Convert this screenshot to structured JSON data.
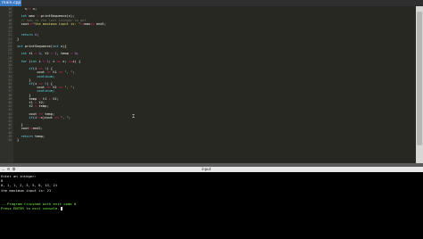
{
  "tab": {
    "label": "main.cpp"
  },
  "editor": {
    "lines": [
      {
        "n": "15",
        "parts": [
          {
            "t": "    s",
            "c": "id"
          },
          {
            "t": "/=",
            "c": "op"
          },
          {
            "t": " x;",
            "c": "id"
          }
        ]
      },
      {
        "n": "16",
        "parts": [
          {
            "t": "  ",
            "c": "id"
          }
        ]
      },
      {
        "n": "17",
        "parts": [
          {
            "t": "  int",
            "c": "ty"
          },
          {
            "t": " max ",
            "c": "id"
          },
          {
            "t": "=",
            "c": "op"
          },
          {
            "t": " printSequence(x);",
            "c": "id"
          }
        ]
      },
      {
        "n": "18",
        "parts": [
          {
            "t": "  // max is the last integer to get",
            "c": "cm"
          }
        ]
      },
      {
        "n": "19",
        "parts": [
          {
            "t": "  cout",
            "c": "id"
          },
          {
            "t": "<<",
            "c": "op"
          },
          {
            "t": "\"the maximum input is: \"",
            "c": "str"
          },
          {
            "t": "<<",
            "c": "op"
          },
          {
            "t": "max",
            "c": "id"
          },
          {
            "t": "<<",
            "c": "op"
          },
          {
            "t": " endl;",
            "c": "id"
          }
        ]
      },
      {
        "n": "20",
        "parts": [
          {
            "t": "",
            "c": "id"
          }
        ]
      },
      {
        "n": "21",
        "parts": [
          {
            "t": "",
            "c": "id"
          }
        ]
      },
      {
        "n": "22",
        "parts": [
          {
            "t": "  return",
            "c": "kw"
          },
          {
            "t": " ",
            "c": "id"
          },
          {
            "t": "0",
            "c": "num"
          },
          {
            "t": ";",
            "c": "id"
          }
        ]
      },
      {
        "n": "23",
        "parts": [
          {
            "t": "}",
            "c": "id"
          }
        ]
      },
      {
        "n": "24",
        "parts": [
          {
            "t": "",
            "c": "id"
          }
        ]
      },
      {
        "n": "25",
        "parts": [
          {
            "t": "int",
            "c": "ty"
          },
          {
            "t": " printSequence(",
            "c": "id"
          },
          {
            "t": "int",
            "c": "ty"
          },
          {
            "t": " x){",
            "c": "id"
          }
        ]
      },
      {
        "n": "26",
        "parts": [
          {
            "t": "",
            "c": "id"
          }
        ]
      },
      {
        "n": "27",
        "parts": [
          {
            "t": "  int",
            "c": "ty"
          },
          {
            "t": " t1 ",
            "c": "id"
          },
          {
            "t": "=",
            "c": "op"
          },
          {
            "t": " ",
            "c": "id"
          },
          {
            "t": "0",
            "c": "num"
          },
          {
            "t": ", t2 ",
            "c": "id"
          },
          {
            "t": "=",
            "c": "op"
          },
          {
            "t": " ",
            "c": "id"
          },
          {
            "t": "1",
            "c": "num"
          },
          {
            "t": ", temp ",
            "c": "id"
          },
          {
            "t": "=",
            "c": "op"
          },
          {
            "t": " ",
            "c": "id"
          },
          {
            "t": "0",
            "c": "num"
          },
          {
            "t": ";",
            "c": "id"
          }
        ]
      },
      {
        "n": "28",
        "parts": [
          {
            "t": "",
            "c": "id"
          }
        ]
      },
      {
        "n": "29",
        "parts": [
          {
            "t": "  for",
            "c": "kw"
          },
          {
            "t": " (",
            "c": "id"
          },
          {
            "t": "int",
            "c": "ty"
          },
          {
            "t": " i ",
            "c": "id"
          },
          {
            "t": "=",
            "c": "op"
          },
          {
            "t": " ",
            "c": "id"
          },
          {
            "t": "1",
            "c": "num"
          },
          {
            "t": "; i ",
            "c": "id"
          },
          {
            "t": "<=",
            "c": "op"
          },
          {
            "t": " x; ",
            "c": "id"
          },
          {
            "t": "++",
            "c": "op"
          },
          {
            "t": "i) {",
            "c": "id"
          }
        ]
      },
      {
        "n": "30",
        "parts": [
          {
            "t": "",
            "c": "id"
          }
        ]
      },
      {
        "n": "31",
        "parts": [
          {
            "t": "      if",
            "c": "kw"
          },
          {
            "t": "(i ",
            "c": "id"
          },
          {
            "t": "==",
            "c": "op"
          },
          {
            "t": " ",
            "c": "id"
          },
          {
            "t": "1",
            "c": "num"
          },
          {
            "t": ") {",
            "c": "id"
          }
        ]
      },
      {
        "n": "32",
        "parts": [
          {
            "t": "          cout ",
            "c": "id"
          },
          {
            "t": "<<",
            "c": "op"
          },
          {
            "t": " t1 ",
            "c": "id"
          },
          {
            "t": "<<",
            "c": "op"
          },
          {
            "t": " \", \"",
            "c": "str"
          },
          {
            "t": ";",
            "c": "id"
          }
        ]
      },
      {
        "n": "33",
        "parts": [
          {
            "t": "          continue",
            "c": "kw"
          },
          {
            "t": ";",
            "c": "id"
          }
        ]
      },
      {
        "n": "34",
        "parts": [
          {
            "t": "      }",
            "c": "id"
          }
        ]
      },
      {
        "n": "35",
        "parts": [
          {
            "t": "      if",
            "c": "kw"
          },
          {
            "t": "(i ",
            "c": "id"
          },
          {
            "t": "==",
            "c": "op"
          },
          {
            "t": " ",
            "c": "id"
          },
          {
            "t": "2",
            "c": "num"
          },
          {
            "t": ") {",
            "c": "id"
          }
        ]
      },
      {
        "n": "36",
        "parts": [
          {
            "t": "          cout ",
            "c": "id"
          },
          {
            "t": "<<",
            "c": "op"
          },
          {
            "t": " t2 ",
            "c": "id"
          },
          {
            "t": "<<",
            "c": "op"
          },
          {
            "t": " \", \"",
            "c": "str"
          },
          {
            "t": ";",
            "c": "id"
          }
        ]
      },
      {
        "n": "37",
        "parts": [
          {
            "t": "          continue",
            "c": "kw"
          },
          {
            "t": ";",
            "c": "id"
          }
        ]
      },
      {
        "n": "38",
        "parts": [
          {
            "t": "      }",
            "c": "id"
          }
        ]
      },
      {
        "n": "39",
        "parts": [
          {
            "t": "      temp ",
            "c": "id"
          },
          {
            "t": "=",
            "c": "op"
          },
          {
            "t": " t1 ",
            "c": "id"
          },
          {
            "t": "+",
            "c": "op"
          },
          {
            "t": " t2;",
            "c": "id"
          }
        ]
      },
      {
        "n": "40",
        "parts": [
          {
            "t": "      t1 ",
            "c": "id"
          },
          {
            "t": "=",
            "c": "op"
          },
          {
            "t": " t2;",
            "c": "id"
          }
        ]
      },
      {
        "n": "41",
        "parts": [
          {
            "t": "      t2 ",
            "c": "id"
          },
          {
            "t": "=",
            "c": "op"
          },
          {
            "t": " temp;",
            "c": "id"
          }
        ]
      },
      {
        "n": "42",
        "parts": [
          {
            "t": "",
            "c": "id"
          }
        ]
      },
      {
        "n": "43",
        "parts": [
          {
            "t": "      cout ",
            "c": "id"
          },
          {
            "t": "<<",
            "c": "op"
          },
          {
            "t": " temp;",
            "c": "id"
          }
        ]
      },
      {
        "n": "44",
        "parts": [
          {
            "t": "      if",
            "c": "kw"
          },
          {
            "t": "(i",
            "c": "id"
          },
          {
            "t": "!=",
            "c": "op"
          },
          {
            "t": "x)cout ",
            "c": "id"
          },
          {
            "t": "<<",
            "c": "op"
          },
          {
            "t": " \", \"",
            "c": "str"
          },
          {
            "t": ";",
            "c": "id"
          }
        ]
      },
      {
        "n": "45",
        "parts": [
          {
            "t": "",
            "c": "id"
          }
        ]
      },
      {
        "n": "46",
        "parts": [
          {
            "t": "  }",
            "c": "id"
          }
        ]
      },
      {
        "n": "47",
        "parts": [
          {
            "t": "  cout",
            "c": "id"
          },
          {
            "t": "<<",
            "c": "op"
          },
          {
            "t": "endl;",
            "c": "id"
          }
        ]
      },
      {
        "n": "48",
        "parts": [
          {
            "t": "",
            "c": "id"
          }
        ]
      },
      {
        "n": "49",
        "parts": [
          {
            "t": "  return",
            "c": "kw"
          },
          {
            "t": " temp;",
            "c": "id"
          }
        ]
      },
      {
        "n": "50",
        "parts": [
          {
            "t": "}",
            "c": "id"
          }
        ]
      }
    ]
  },
  "io_bar": {
    "label": "input"
  },
  "console": {
    "lines": [
      {
        "text": "Enter an integer:",
        "color": "white"
      },
      {
        "text": "8",
        "color": "white"
      },
      {
        "text": "0, 1, 1, 2, 3, 5, 8, 13, 21",
        "color": "white"
      },
      {
        "text": "the maximum input is: 21",
        "color": "white"
      },
      {
        "text": "",
        "color": "white"
      },
      {
        "text": "",
        "color": "white"
      },
      {
        "text": "...Program finished with exit code 0",
        "color": "green"
      },
      {
        "text": "Press ENTER to exit console.",
        "color": "green"
      }
    ]
  }
}
